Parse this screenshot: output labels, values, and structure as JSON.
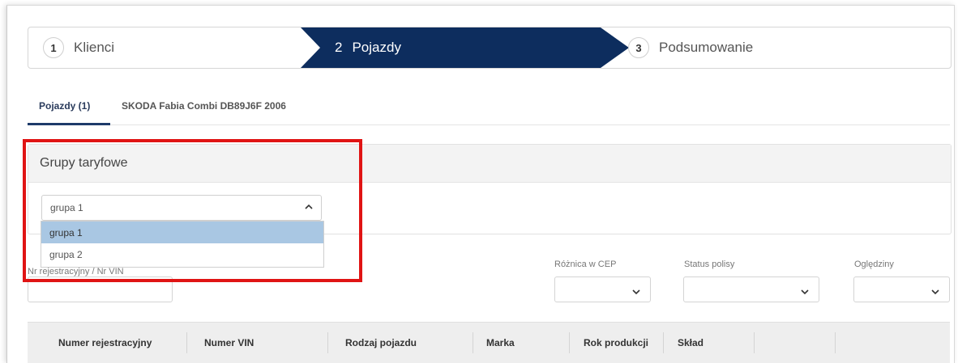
{
  "stepper": {
    "steps": [
      {
        "number": "1",
        "label": "Klienci"
      },
      {
        "number": "2",
        "label": "Pojazdy"
      },
      {
        "number": "3",
        "label": "Podsumowanie"
      }
    ],
    "active_color": "#0d2d5e"
  },
  "tabs": {
    "items": [
      {
        "label": "Pojazdy (1)"
      },
      {
        "label": "SKODA Fabia Combi DB89J6F 2006"
      }
    ]
  },
  "tariff_groups": {
    "title": "Grupy taryfowe",
    "selected": "grupa 1",
    "options": [
      "grupa 1",
      "grupa 2"
    ]
  },
  "filters": {
    "registration_label": "Nr rejestracyjny / Nr VIN",
    "cep_label": "Różnica w CEP",
    "policy_status_label": "Status polisy",
    "inspection_label": "Oględziny"
  },
  "table": {
    "columns": [
      "Numer rejestracyjny",
      "Numer VIN",
      "Rodzaj pojazdu",
      "Marka",
      "Rok produkcji",
      "Skład"
    ]
  },
  "highlight_color": "#e01414"
}
